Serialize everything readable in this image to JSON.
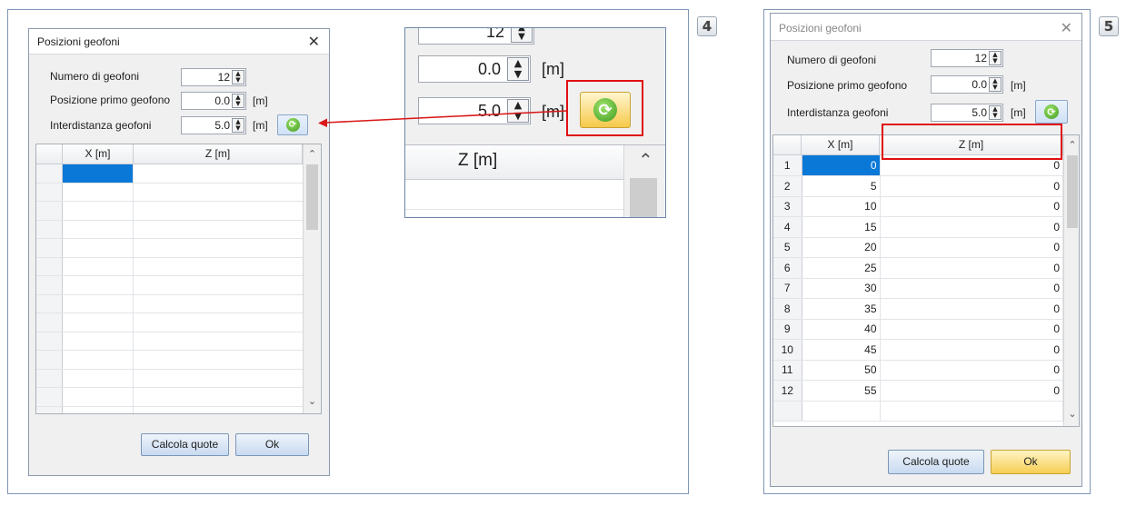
{
  "step4": {
    "number": "4"
  },
  "step5": {
    "number": "5"
  },
  "dialog": {
    "title": "Posizioni geofoni",
    "fields": {
      "count_label": "Numero di geofoni",
      "count_value": "12",
      "first_label": "Posizione primo geofono",
      "first_value": "0.0",
      "first_unit": "[m]",
      "spacing_label": "Interdistanza geofoni",
      "spacing_value": "5.0",
      "spacing_unit": "[m]"
    },
    "grid": {
      "col_x": "X [m]",
      "col_z": "Z [m]"
    },
    "buttons": {
      "calc": "Calcola quote",
      "ok": "Ok"
    },
    "rows": [
      {
        "n": "1",
        "x": "0",
        "z": "0"
      },
      {
        "n": "2",
        "x": "5",
        "z": "0"
      },
      {
        "n": "3",
        "x": "10",
        "z": "0"
      },
      {
        "n": "4",
        "x": "15",
        "z": "0"
      },
      {
        "n": "5",
        "x": "20",
        "z": "0"
      },
      {
        "n": "6",
        "x": "25",
        "z": "0"
      },
      {
        "n": "7",
        "x": "30",
        "z": "0"
      },
      {
        "n": "8",
        "x": "35",
        "z": "0"
      },
      {
        "n": "9",
        "x": "40",
        "z": "0"
      },
      {
        "n": "10",
        "x": "45",
        "z": "0"
      },
      {
        "n": "11",
        "x": "50",
        "z": "0"
      },
      {
        "n": "12",
        "x": "55",
        "z": "0"
      }
    ]
  },
  "zoom": {
    "count_value": "12",
    "first_value": "0.0",
    "first_unit": "[m]",
    "spacing_value": "5.0",
    "spacing_unit": "[m]",
    "col_z": "Z [m]"
  },
  "colors": {
    "highlight": "#e01010",
    "arrow": "#d81818",
    "selected_cell": "#0a78d7"
  }
}
